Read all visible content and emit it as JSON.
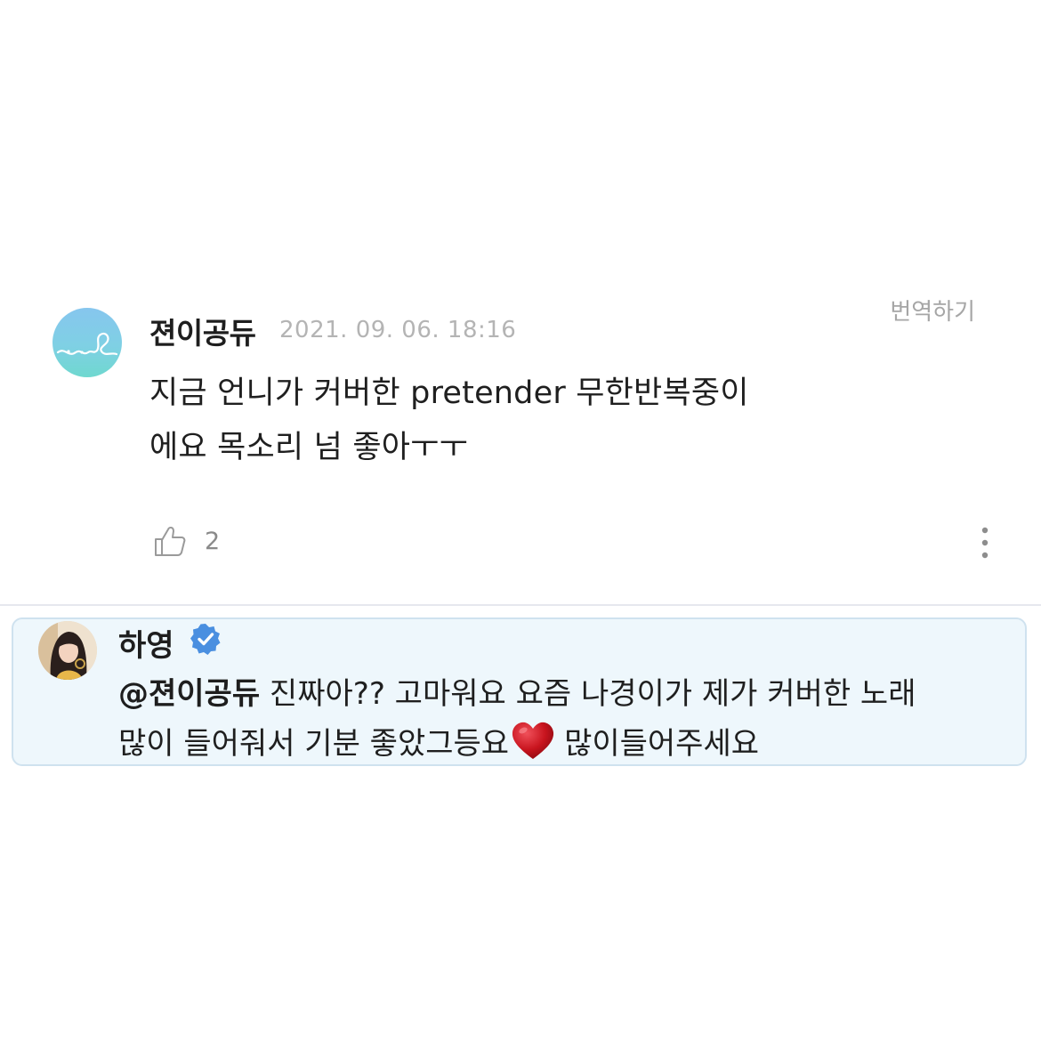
{
  "comment": {
    "username": "젼이공듀",
    "timestamp": "2021. 09. 06. 18:16",
    "translate_label": "번역하기",
    "body_line1": "지금 언니가 커버한 pretender 무한반복중이",
    "body_line2": "에요 목소리 넘 좋아ㅜㅜ",
    "likes": "2",
    "avatar_color": "#86c6ee"
  },
  "reply": {
    "username": "하영",
    "verified": true,
    "mention": "@젼이공듀",
    "line1_rest": " 진짜아?? 고마워요 요즘 나경이가 제가 커버한 노래",
    "line2_before_heart": "많이 들어줘서 기분 좋았그등요",
    "line2_after_heart": "많이들어주세요",
    "heart_color": "#c8141e",
    "verified_color": "#4a8fe0",
    "background_color": "#eef7fc"
  },
  "icons": {
    "like": "thumbs-up-icon",
    "more": "more-vertical-icon",
    "verified": "verified-badge-icon",
    "heart": "heart-emoji-icon"
  }
}
